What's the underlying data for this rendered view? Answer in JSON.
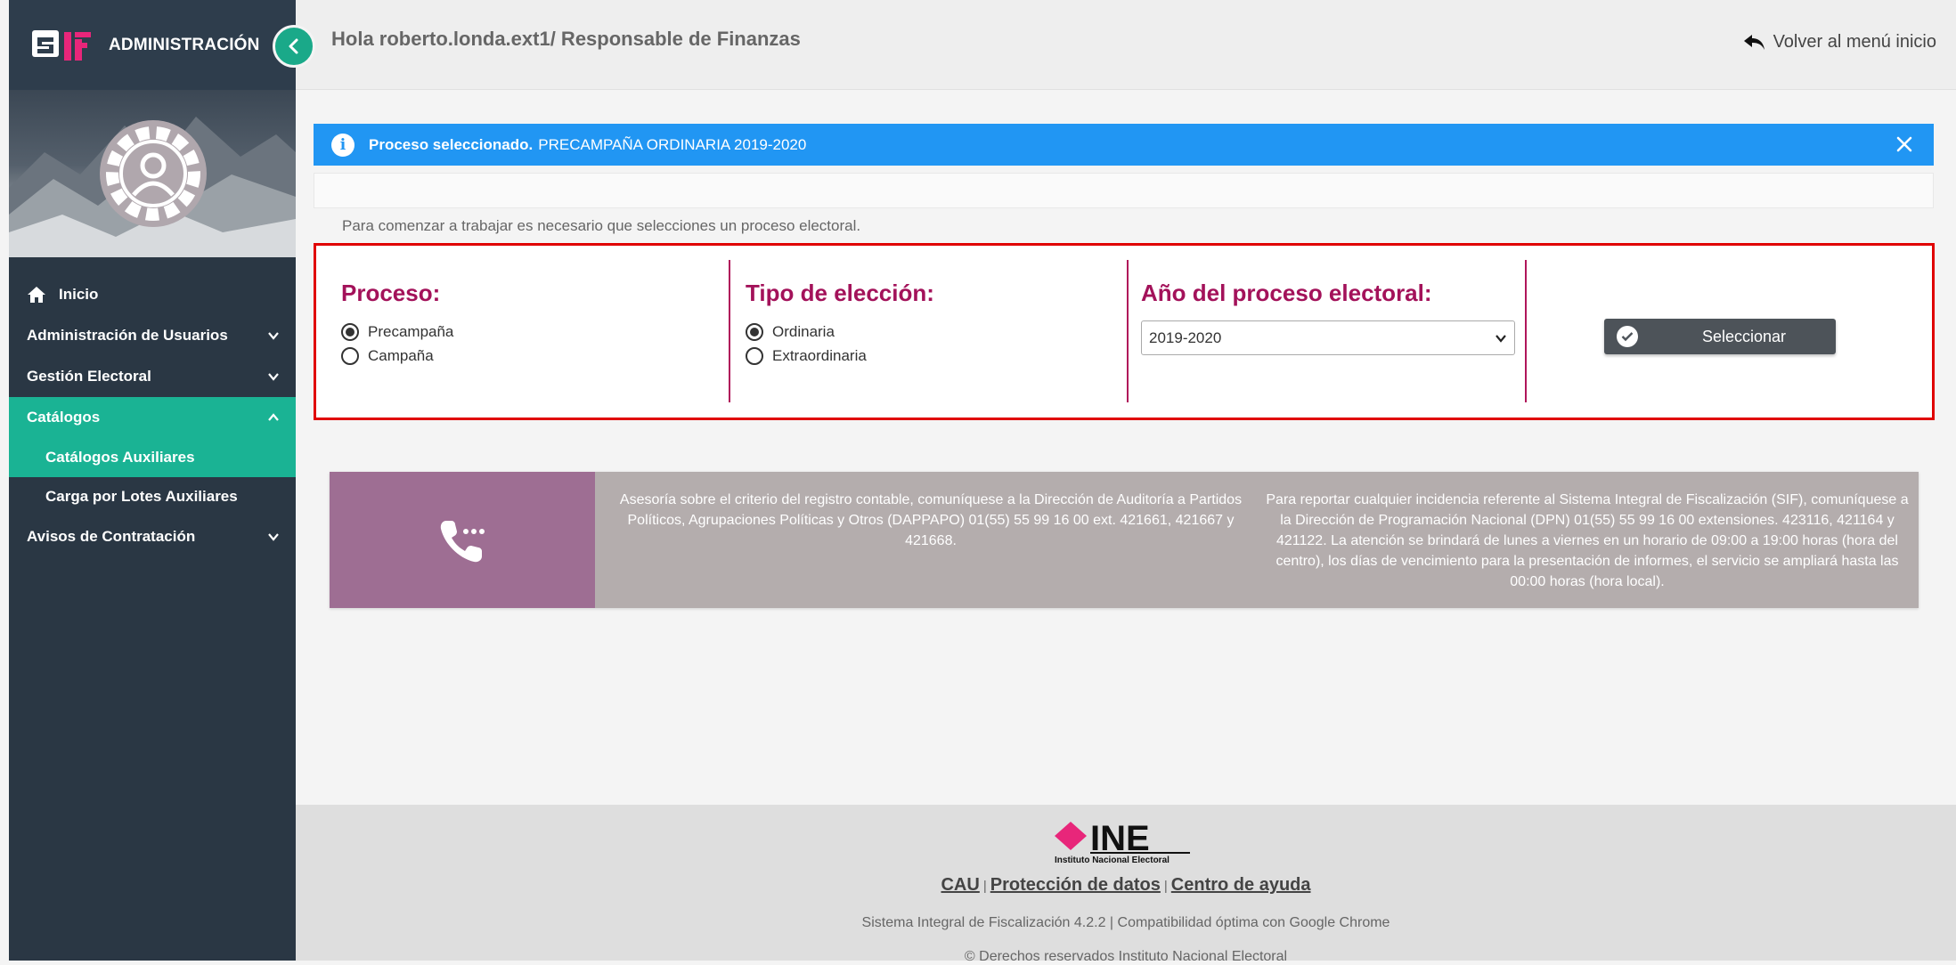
{
  "sidebar": {
    "app_title": "ADMINISTRACIÓN",
    "items": [
      {
        "label": "Inicio"
      },
      {
        "label": "Administración de Usuarios"
      },
      {
        "label": "Gestión Electoral"
      },
      {
        "label": "Catálogos"
      },
      {
        "label": "Catálogos Auxiliares"
      },
      {
        "label": "Carga por Lotes Auxiliares"
      },
      {
        "label": "Avisos de Contratación"
      }
    ]
  },
  "header": {
    "greeting": "Hola roberto.londa.ext1/ Responsable de Finanzas",
    "back_label": "Volver al menú inicio"
  },
  "alert": {
    "label": "Proceso seleccionado.",
    "value": "PRECAMPAÑA ORDINARIA 2019-2020"
  },
  "hint": "Para comenzar a trabajar es necesario que selecciones un proceso electoral.",
  "form": {
    "proceso": {
      "title": "Proceso:",
      "options": [
        "Precampaña",
        "Campaña"
      ],
      "selected": "Precampaña"
    },
    "tipo": {
      "title": "Tipo de elección:",
      "options": [
        "Ordinaria",
        "Extraordinaria"
      ],
      "selected": "Ordinaria"
    },
    "anio": {
      "title": "Año del proceso electoral:",
      "value": "2019-2020"
    },
    "button_label": "Seleccionar"
  },
  "info": {
    "left": "Asesoría sobre el criterio del registro contable, comuníquese a la Dirección de Auditoría a Partidos Políticos, Agrupaciones Políticas y Otros (DAPPAPO) 01(55) 55 99 16 00 ext. 421661, 421667 y 421668.",
    "right": "Para reportar cualquier incidencia referente al Sistema Integral de Fiscalización (SIF), comuníquese a la Dirección de Programación Nacional (DPN) 01(55) 55 99 16 00 extensiones. 423116, 421164 y 421122. La atención se brindará de lunes a viernes en un horario de 09:00 a 19:00 horas (hora del centro), los días de vencimiento para la presentación de informes, el servicio se ampliará hasta las 00:00 horas (hora local)."
  },
  "footer": {
    "logo_text": "INE",
    "logo_subtitle": "Instituto Nacional Electoral",
    "links": [
      "CAU",
      "Protección de datos",
      "Centro de ayuda"
    ],
    "version": "Sistema Integral de Fiscalización 4.2.2 | Compatibilidad óptima con Google Chrome",
    "rights": "© Derechos reservados Instituto Nacional Electoral"
  },
  "colors": {
    "sidebar_bg": "#2a3744",
    "accent_green": "#1ab394",
    "alert_blue": "#2196f3",
    "title_magenta": "#a3125a",
    "highlight_red": "#e00000",
    "band_purple": "#9e6e93",
    "band_gray": "#b4adad"
  }
}
